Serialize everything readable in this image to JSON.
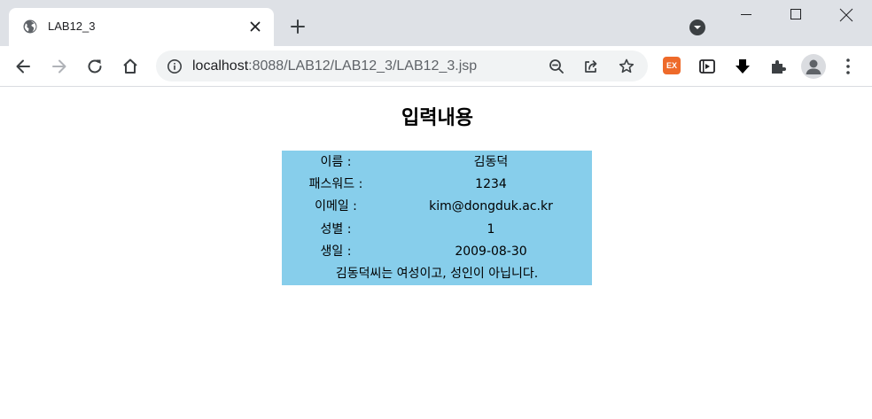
{
  "browser": {
    "tab": {
      "title": "LAB12_3"
    },
    "address_bar": {
      "host": "localhost",
      "path": ":8088/LAB12/LAB12_3/LAB12_3.jsp"
    },
    "extensions": {
      "ex_label": "EX"
    }
  },
  "page": {
    "heading": "입력내용",
    "table": {
      "background": "#87ceeb",
      "rows": [
        {
          "label": "이름 :",
          "value": "김동덕"
        },
        {
          "label": "패스워드 :",
          "value": "1234"
        },
        {
          "label": "이메일 :",
          "value": "kim@dongduk.ac.kr"
        },
        {
          "label": "성별 :",
          "value": "1"
        },
        {
          "label": "생일 :",
          "value": "2009-08-30"
        }
      ],
      "summary": "김동덕씨는 여성이고, 성인이 아닙니다."
    }
  }
}
